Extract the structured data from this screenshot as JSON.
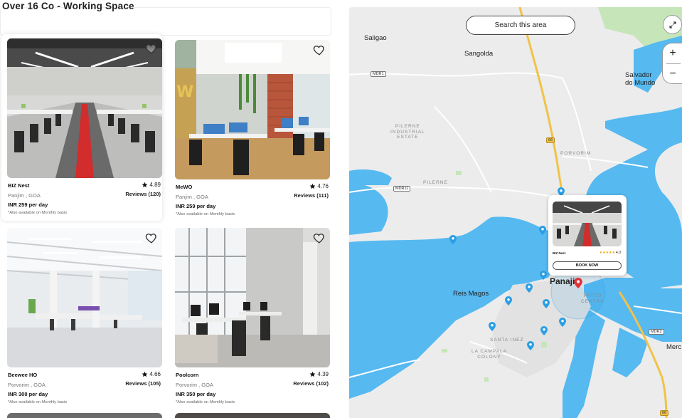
{
  "listing": {
    "title": "Over 16 Co - Working  Space",
    "cards": [
      {
        "name": "BIZ Nest",
        "rating": "4.89",
        "location": "Panjim , GOA",
        "reviews": "Reviews (120)",
        "price": "INR 259 per day",
        "note": "*Also available on Monthly basis"
      },
      {
        "name": "MeWO",
        "rating": "4.76",
        "location": "Panjim , GOA",
        "reviews": "Reviews (111)",
        "price": "INR 259 per day",
        "note": "*Also available on Monthly basis"
      },
      {
        "name": "Beewee HO",
        "rating": "4.66",
        "location": "Porvorim , GOA",
        "reviews": "Reviews (105)",
        "price": "INR 300 per day",
        "note": "*Also available on Monthly basis"
      },
      {
        "name": "Poolcorn",
        "rating": "4.39",
        "location": "Porvorim , GOA",
        "reviews": "Reviews (102)",
        "price": "INR 350 per day",
        "note": "*Also available on Monthly basis"
      }
    ]
  },
  "map": {
    "search_area_label": "Search this area",
    "zoom_in": "+",
    "zoom_out": "−",
    "labels": {
      "saligao": "Saligao",
      "sangolda": "Sangolda",
      "salvador": "Salvador\ndo Mundo",
      "pilerne_estate": "PILERNE\nINDUSTRIAL\nESTATE",
      "pilerne": "PILERNE",
      "porvorim": "PORVORIM",
      "reis_magos": "Reis Magos",
      "panaji": "Panaji",
      "patto": "PATTO\nCENTRE",
      "santa_inez": "SANTA INEZ",
      "la_campala": "LA CAMPALA\nCOLONY",
      "merc": "Merc"
    },
    "road_tags": {
      "mdr1": "MDR1",
      "mdr11": "MDR11",
      "mdr2": "MDR2",
      "nh66a": "66",
      "nh66b": "66"
    },
    "popup": {
      "name": "BIZ Nest",
      "rating": "4.0",
      "book_label": "BOOK NOW"
    },
    "colors": {
      "water": "#56b9f0",
      "land": "#ececec",
      "park": "#c6e5b9",
      "highway": "#f1c24a",
      "pin": "#2a9fe5",
      "pin_active": "#e0323a"
    }
  }
}
